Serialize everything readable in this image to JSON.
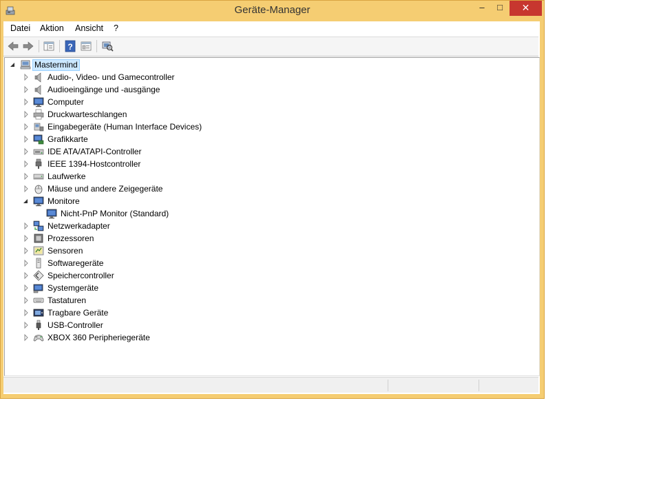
{
  "window": {
    "title": "Geräte-Manager",
    "controls": {
      "minimize": "–",
      "maximize": "□",
      "close": "✕"
    }
  },
  "menu": [
    "Datei",
    "Aktion",
    "Ansicht",
    "?"
  ],
  "toolbar": [
    {
      "name": "back-icon"
    },
    {
      "name": "forward-icon"
    },
    {
      "name": "show-hide-console-tree-icon"
    },
    {
      "name": "help-icon"
    },
    {
      "name": "properties-icon"
    },
    {
      "name": "scan-hardware-icon"
    }
  ],
  "tree": {
    "root": {
      "label": "Mastermind",
      "expanded": true,
      "icon": "computer-icon"
    },
    "categories": [
      {
        "label": "Audio-, Video- und Gamecontroller",
        "icon": "speaker-icon",
        "expanded": false
      },
      {
        "label": "Audioeingänge und -ausgänge",
        "icon": "speaker-icon",
        "expanded": false
      },
      {
        "label": "Computer",
        "icon": "monitor-icon",
        "expanded": false
      },
      {
        "label": "Druckwarteschlangen",
        "icon": "printer-icon",
        "expanded": false
      },
      {
        "label": "Eingabegeräte (Human Interface Devices)",
        "icon": "hid-icon",
        "expanded": false
      },
      {
        "label": "Grafikkarte",
        "icon": "display-adapter-icon",
        "expanded": false
      },
      {
        "label": "IDE ATA/ATAPI-Controller",
        "icon": "ide-controller-icon",
        "expanded": false
      },
      {
        "label": "IEEE 1394-Hostcontroller",
        "icon": "firewire-icon",
        "expanded": false
      },
      {
        "label": "Laufwerke",
        "icon": "disk-drive-icon",
        "expanded": false
      },
      {
        "label": "Mäuse und andere Zeigegeräte",
        "icon": "mouse-icon",
        "expanded": false
      },
      {
        "label": "Monitore",
        "icon": "monitor-icon",
        "expanded": true,
        "children": [
          {
            "label": "Nicht-PnP Monitor (Standard)",
            "icon": "monitor-icon"
          }
        ]
      },
      {
        "label": "Netzwerkadapter",
        "icon": "network-adapter-icon",
        "expanded": false
      },
      {
        "label": "Prozessoren",
        "icon": "processor-icon",
        "expanded": false
      },
      {
        "label": "Sensoren",
        "icon": "sensor-icon",
        "expanded": false
      },
      {
        "label": "Softwaregeräte",
        "icon": "software-device-icon",
        "expanded": false
      },
      {
        "label": "Speichercontroller",
        "icon": "storage-controller-icon",
        "expanded": false
      },
      {
        "label": "Systemgeräte",
        "icon": "system-device-icon",
        "expanded": false
      },
      {
        "label": "Tastaturen",
        "icon": "keyboard-icon",
        "expanded": false
      },
      {
        "label": "Tragbare Geräte",
        "icon": "portable-device-icon",
        "expanded": false
      },
      {
        "label": "USB-Controller",
        "icon": "usb-icon",
        "expanded": false
      },
      {
        "label": "XBOX 360 Peripheriegeräte",
        "icon": "gamepad-icon",
        "expanded": false
      }
    ]
  },
  "colors": {
    "frame": "#f5cd72",
    "close_button": "#c7372f",
    "selection_fill": "#cce8ff",
    "selection_border": "#99d1ff"
  }
}
